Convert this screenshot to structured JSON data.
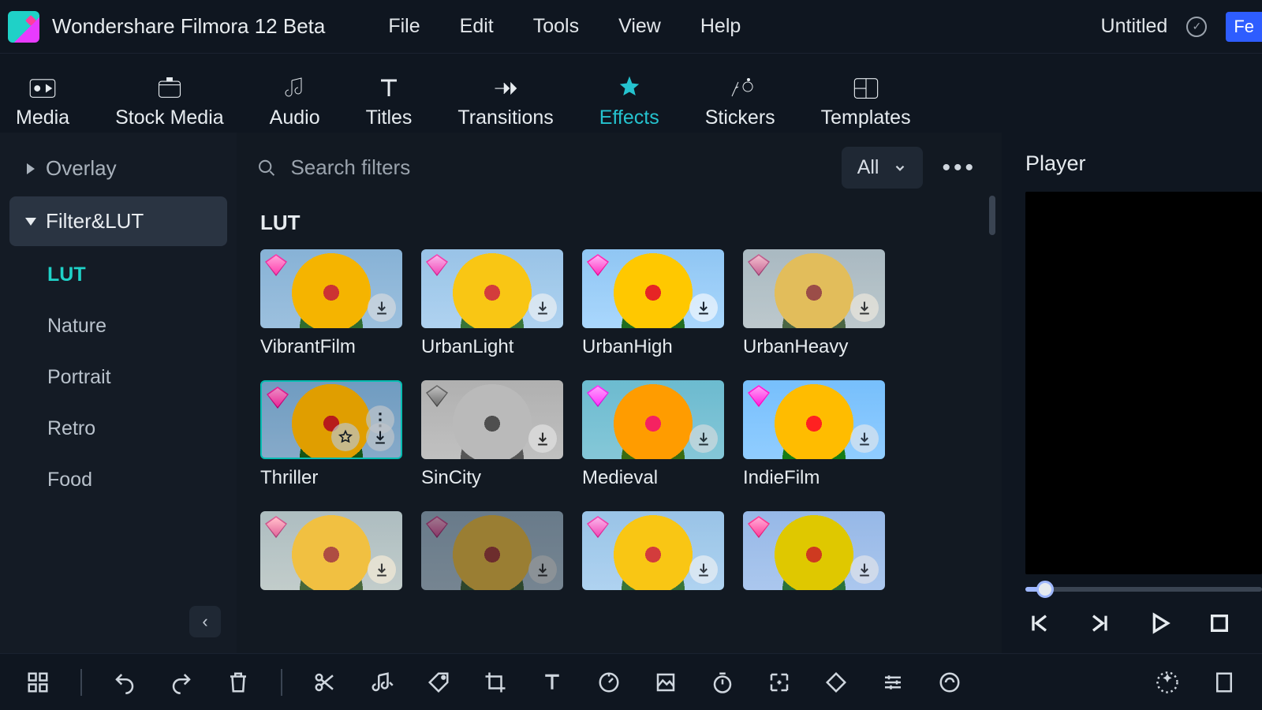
{
  "app": {
    "title": "Wondershare Filmora 12 Beta"
  },
  "menu": {
    "file": "File",
    "edit": "Edit",
    "tools": "Tools",
    "view": "View",
    "help": "Help"
  },
  "project": {
    "name": "Untitled",
    "fe_button": "Fe"
  },
  "tabs": {
    "media": "Media",
    "stock": "Stock Media",
    "audio": "Audio",
    "titles": "Titles",
    "transitions": "Transitions",
    "effects": "Effects",
    "stickers": "Stickers",
    "templates": "Templates"
  },
  "sidebar": {
    "overlay": "Overlay",
    "filterlut": "Filter&LUT",
    "subs": [
      "LUT",
      "Nature",
      "Portrait",
      "Retro",
      "Food"
    ]
  },
  "content": {
    "search_placeholder": "Search filters",
    "filter_dd": "All",
    "section": "LUT",
    "items": [
      {
        "label": "VibrantFilm"
      },
      {
        "label": "UrbanLight"
      },
      {
        "label": "UrbanHigh"
      },
      {
        "label": "UrbanHeavy"
      },
      {
        "label": "Thriller"
      },
      {
        "label": "SinCity"
      },
      {
        "label": "Medieval"
      },
      {
        "label": "IndieFilm"
      },
      {
        "label": ""
      },
      {
        "label": ""
      },
      {
        "label": ""
      },
      {
        "label": ""
      }
    ]
  },
  "player": {
    "title": "Player"
  }
}
